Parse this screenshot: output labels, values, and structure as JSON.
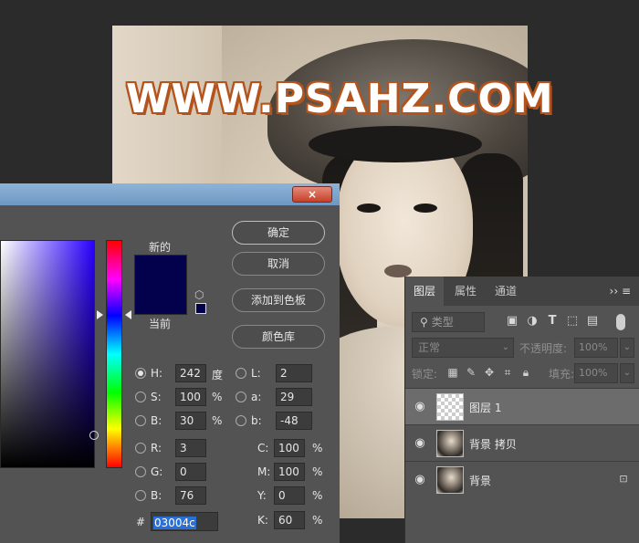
{
  "canvas": {
    "watermark": "WWW.PSAHZ.COM"
  },
  "color_picker": {
    "close_label": "×",
    "new_label": "新的",
    "current_label": "当前",
    "new_color": "#03004c",
    "buttons": {
      "ok": "确定",
      "cancel": "取消",
      "add_to_swatches": "添加到色板",
      "color_libraries": "颜色库"
    },
    "hsb": {
      "h_label": "H:",
      "h_value": "242",
      "h_unit": "度",
      "s_label": "S:",
      "s_value": "100",
      "s_unit": "%",
      "b_label": "B:",
      "b_value": "30",
      "b_unit": "%"
    },
    "lab": {
      "l_label": "L:",
      "l_value": "2",
      "a_label": "a:",
      "a_value": "29",
      "b_label": "b:",
      "b_value": "-48"
    },
    "rgb": {
      "r_label": "R:",
      "r_value": "3",
      "g_label": "G:",
      "g_value": "0",
      "b_label": "B:",
      "b_value": "76"
    },
    "cmyk": {
      "c_label": "C:",
      "c_value": "100",
      "m_label": "M:",
      "m_value": "100",
      "y_label": "Y:",
      "y_value": "0",
      "k_label": "K:",
      "k_value": "60",
      "unit": "%"
    },
    "hex_hash": "#",
    "hex_value": "03004c"
  },
  "layers_panel": {
    "tabs": [
      "图层",
      "属性",
      "通道"
    ],
    "menu_glyph": "›› ≡",
    "filter_label": "类型",
    "blend_mode": "正常",
    "opacity_label": "不透明度:",
    "opacity_value": "100%",
    "lock_label": "锁定:",
    "fill_label": "填充:",
    "fill_value": "100%",
    "layers": [
      {
        "name": "图层 1",
        "selected": true
      },
      {
        "name": "背景 拷贝",
        "selected": false
      },
      {
        "name": "背景",
        "selected": false
      }
    ]
  }
}
